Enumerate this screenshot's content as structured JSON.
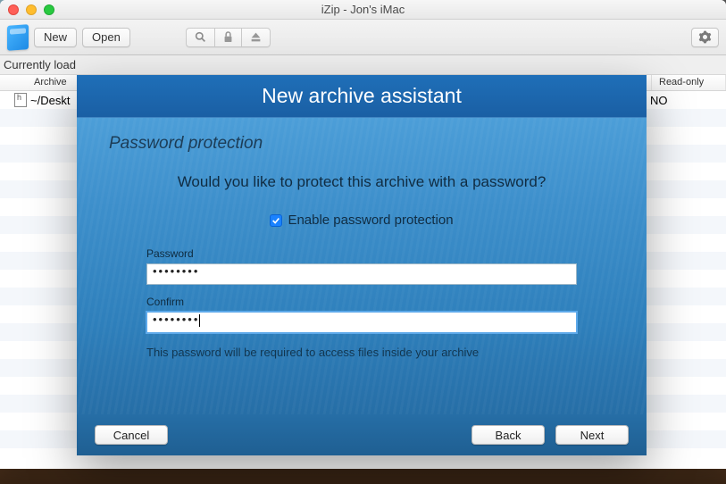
{
  "window": {
    "title": "iZip - Jon's iMac"
  },
  "toolbar": {
    "new_label": "New",
    "open_label": "Open"
  },
  "infobar": {
    "text": "Currently load"
  },
  "table": {
    "headers": {
      "archive": "Archive",
      "readonly": "Read-only"
    },
    "row": {
      "archive": "~/Deskt",
      "readonly": "NO"
    }
  },
  "sheet": {
    "title": "New archive assistant",
    "section_title": "Password protection",
    "prompt": "Would you like to protect this archive with a password?",
    "checkbox_label": "Enable password protection",
    "checkbox_checked": true,
    "password_label": "Password",
    "password_value": "••••••••",
    "confirm_label": "Confirm",
    "confirm_value": "••••••••",
    "hint": "This password will be required to access files inside your archive",
    "buttons": {
      "cancel": "Cancel",
      "back": "Back",
      "next": "Next"
    }
  }
}
